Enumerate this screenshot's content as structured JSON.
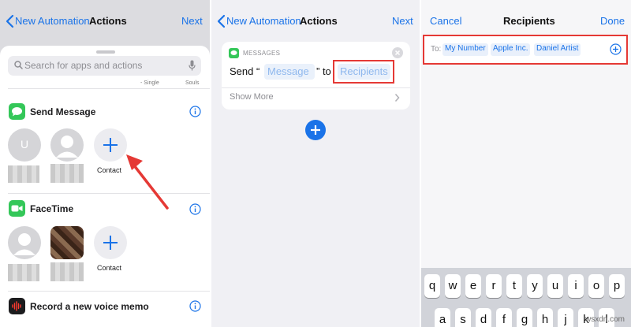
{
  "panel1": {
    "nav": {
      "back_label": "New Automation",
      "title": "Actions",
      "next_label": "Next"
    },
    "search": {
      "placeholder": "Search for apps and actions"
    },
    "faint_labels": [
      "- Single",
      "Souls"
    ],
    "send_message": {
      "title": "Send Message",
      "contacts": [
        {
          "initial": "U"
        },
        {
          "initial": ""
        }
      ],
      "add_label": "Contact"
    },
    "facetime": {
      "title": "FaceTime",
      "add_label": "Contact"
    },
    "voice_memo": {
      "title": "Record a new voice memo"
    },
    "colors": {
      "accent": "#1a73e8",
      "messages_green": "#34c759",
      "annotation_red": "#e53935"
    }
  },
  "panel2": {
    "nav": {
      "back_label": "New Automation",
      "title": "Actions",
      "next_label": "Next"
    },
    "card": {
      "app_label": "MESSAGES",
      "text_send": "Send “",
      "message_param": "Message",
      "text_to": "” to",
      "recipients_param": "Recipients",
      "show_more": "Show More"
    }
  },
  "panel3": {
    "nav": {
      "cancel_label": "Cancel",
      "title": "Recipients",
      "done_label": "Done"
    },
    "to_label": "To:",
    "recipients": [
      "My Number",
      "Apple Inc.",
      "Daniel Artist"
    ],
    "keyboard_rows": [
      [
        "q",
        "w",
        "e",
        "r",
        "t",
        "y",
        "u",
        "i",
        "o",
        "p"
      ],
      [
        "a",
        "s",
        "d",
        "f",
        "g",
        "h",
        "j",
        "k",
        "l"
      ]
    ]
  },
  "watermark": "wsxdn.com"
}
